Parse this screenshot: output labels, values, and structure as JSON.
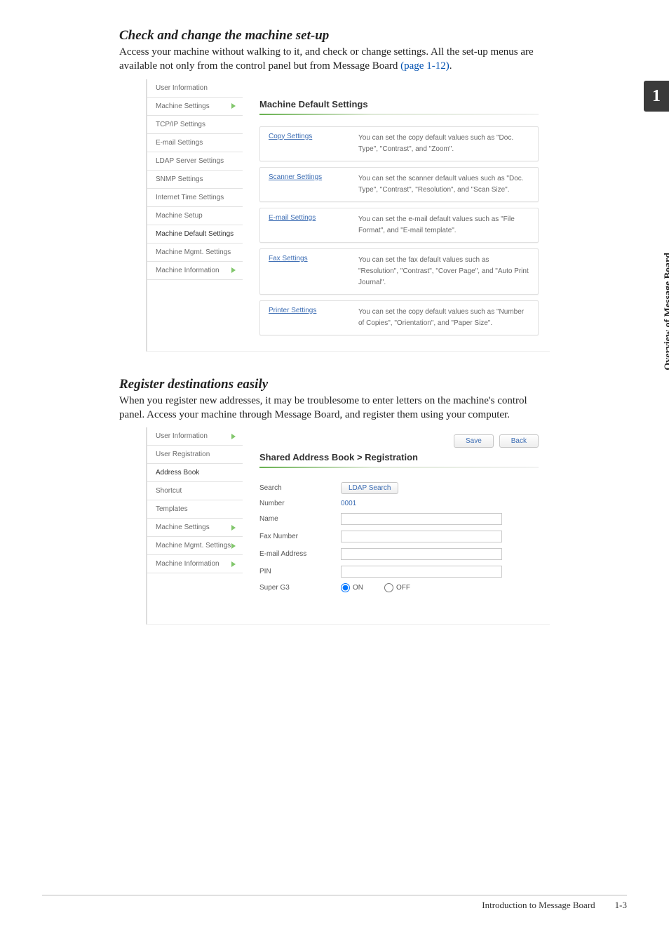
{
  "side_tab_number": "1",
  "side_label": "Overview of Message Board",
  "section1": {
    "title": "Check and change the machine set-up",
    "body_a": "Access your machine without walking to it, and check or change settings.  All the set-up menus are available not only from the control panel but from Message Board ",
    "body_link": "(page 1-12)",
    "body_b": "."
  },
  "screenshot1": {
    "sidebar": [
      {
        "label": "User Information",
        "tri": false
      },
      {
        "label": "Machine Settings",
        "tri": true
      },
      {
        "label": "TCP/IP Settings",
        "tri": false
      },
      {
        "label": "E-mail Settings",
        "tri": false
      },
      {
        "label": "LDAP Server Settings",
        "tri": false
      },
      {
        "label": "SNMP Settings",
        "tri": false
      },
      {
        "label": "Internet Time Settings",
        "tri": false
      },
      {
        "label": "Machine Setup",
        "tri": false
      },
      {
        "label": "Machine Default Settings",
        "tri": false
      },
      {
        "label": "Machine Mgmt. Settings",
        "tri": false
      },
      {
        "label": "Machine Information",
        "tri": true
      }
    ],
    "heading": "Machine Default Settings",
    "cards": [
      {
        "link": "Copy Settings",
        "desc": "You can set the copy default values such as \"Doc. Type\", \"Contrast\", and \"Zoom\"."
      },
      {
        "link": "Scanner Settings",
        "desc": "You can set the scanner default values such as \"Doc. Type\", \"Contrast\", \"Resolution\", and \"Scan Size\"."
      },
      {
        "link": "E-mail Settings",
        "desc": "You can set the e-mail default values such as \"File Format\", and \"E-mail template\"."
      },
      {
        "link": "Fax Settings",
        "desc": "You can set the fax default values such as \"Resolution\", \"Contrast\", \"Cover Page\", and \"Auto Print Journal\"."
      },
      {
        "link": "Printer Settings",
        "desc": "You can set the copy default values such as \"Number of Copies\", \"Orientation\", and \"Paper Size\"."
      }
    ]
  },
  "section2": {
    "title": "Register destinations easily",
    "body": "When you register new addresses, it may be troublesome to enter letters on the machine's control panel.  Access your machine through Message Board, and register them using your computer."
  },
  "screenshot2": {
    "sidebar": [
      {
        "label": "User Information",
        "tri": true
      },
      {
        "label": "User Registration",
        "tri": false
      },
      {
        "label": "Address Book",
        "tri": false
      },
      {
        "label": "Shortcut",
        "tri": false
      },
      {
        "label": "Templates",
        "tri": false
      },
      {
        "label": "Machine Settings",
        "tri": true
      },
      {
        "label": "Machine Mgmt. Settings",
        "tri": true
      },
      {
        "label": "Machine Information",
        "tri": true
      }
    ],
    "btn_save": "Save",
    "btn_back": "Back",
    "heading": "Shared Address Book > Registration",
    "form": {
      "search_lbl": "Search",
      "ldap_btn": "LDAP Search",
      "number_lbl": "Number",
      "number_val": "0001",
      "name_lbl": "Name",
      "fax_lbl": "Fax Number",
      "email_lbl": "E-mail Address",
      "pin_lbl": "PIN",
      "sg3_lbl": "Super G3",
      "on": "ON",
      "off": "OFF"
    }
  },
  "footer": {
    "text": "Introduction to Message Board",
    "page": "1-3"
  }
}
